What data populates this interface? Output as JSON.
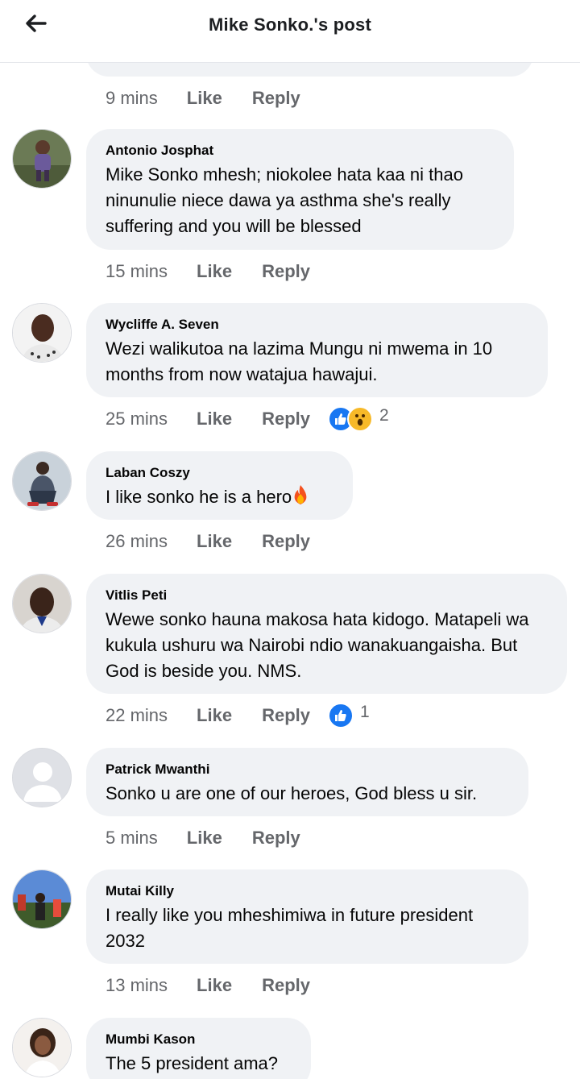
{
  "header": {
    "title": "Mike Sonko.'s post",
    "back_icon": "arrow-left-icon"
  },
  "previous_comment": {
    "time": "9 mins",
    "like_label": "Like",
    "reply_label": "Reply"
  },
  "comments": [
    {
      "author": "Antonio Josphat",
      "text": "Mike Sonko mhesh; niokolee hata kaa ni thao ninunulie niece dawa ya asthma she's really suffering and you will be blessed",
      "time": "15 mins",
      "like_label": "Like",
      "reply_label": "Reply"
    },
    {
      "author": "Wycliffe A. Seven",
      "text": "Wezi walikutoa na lazima Mungu ni mwema in 10 months from now watajua hawajui.",
      "time": "25 mins",
      "like_label": "Like",
      "reply_label": "Reply",
      "reactions": [
        "like-reaction-icon",
        "wow-reaction-icon"
      ],
      "reaction_count": "2"
    },
    {
      "author": "Laban Coszy",
      "text": "I like sonko he is a hero",
      "emoji": "fire-emoji-icon",
      "time": "26 mins",
      "like_label": "Like",
      "reply_label": "Reply"
    },
    {
      "author": "Vitlis Peti",
      "text": "Wewe sonko hauna makosa hata kidogo. Matapeli wa kukula ushuru wa Nairobi ndio wanakuangaisha. But God is beside you. NMS.",
      "time": "22 mins",
      "like_label": "Like",
      "reply_label": "Reply",
      "reactions": [
        "like-reaction-icon"
      ],
      "reaction_count": "1"
    },
    {
      "author": "Patrick Mwanthi",
      "text": "Sonko u are one of our heroes, God bless u sir.",
      "time": "5 mins",
      "like_label": "Like",
      "reply_label": "Reply"
    },
    {
      "author": "Mutai Killy",
      "text": "I really like you mheshimiwa in future president 2032",
      "time": "13 mins",
      "like_label": "Like",
      "reply_label": "Reply"
    },
    {
      "author": "Mumbi Kason",
      "text": "The 5 president ama?"
    }
  ],
  "colors": {
    "bubble": "#f0f2f5",
    "muted_text": "#65676b",
    "like_blue": "#1877f2",
    "wow_yellow": "#f7b928"
  }
}
